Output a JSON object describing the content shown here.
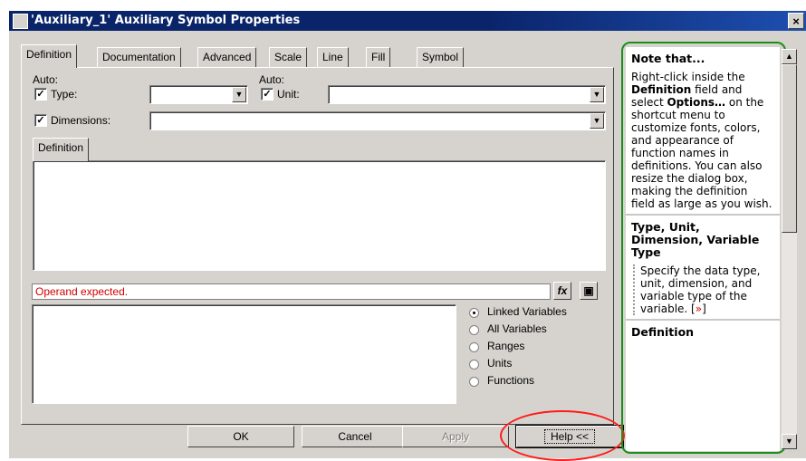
{
  "window": {
    "title": "'Auxiliary_1' Auxiliary Symbol Properties",
    "close_glyph": "×"
  },
  "tabs": [
    {
      "label": "Definition"
    },
    {
      "label": "Documentation"
    },
    {
      "label": "Advanced"
    },
    {
      "label": "Scale"
    },
    {
      "label": "Line"
    },
    {
      "label": "Fill"
    },
    {
      "label": "Symbol"
    }
  ],
  "form": {
    "auto_label_1": "Auto:",
    "auto_label_2": "Auto:",
    "type_label": "Type:",
    "type_value": "",
    "unit_label": "Unit:",
    "unit_value": "",
    "dimensions_label": "Dimensions:",
    "dimensions_value": "",
    "definition_tab": "Definition"
  },
  "status": {
    "error": "Operand expected.",
    "error_color": "#d00000"
  },
  "radios": [
    {
      "label": "Linked Variables",
      "selected": true
    },
    {
      "label": "All Variables",
      "selected": false
    },
    {
      "label": "Ranges",
      "selected": false
    },
    {
      "label": "Units",
      "selected": false
    },
    {
      "label": "Functions",
      "selected": false
    }
  ],
  "buttons": {
    "ok": "OK",
    "cancel": "Cancel",
    "apply": "Apply",
    "help": "Help <<"
  },
  "note": {
    "heading": "Note that...",
    "body_1": "Right-click inside the ",
    "body_bold_1": "Definition",
    "body_2": " field and select ",
    "body_bold_2": "Options…",
    "body_3": " on the shortcut menu to customize fonts, colors, and appearance of function names in definitions. You can also resize the dialog box, making the definition field as large as you wish.",
    "section2_heading": "Type, Unit, Dimension, Variable Type",
    "section2_body": "Specify the data type, unit, dimension, and variable type of the variable. [",
    "section2_link": "»",
    "section2_end": "]",
    "section3_heading": "Definition"
  },
  "colors": {
    "titlebar": "#0a246a",
    "highlight_green": "#1a8f1a",
    "highlight_red": "#ff1a1a"
  }
}
